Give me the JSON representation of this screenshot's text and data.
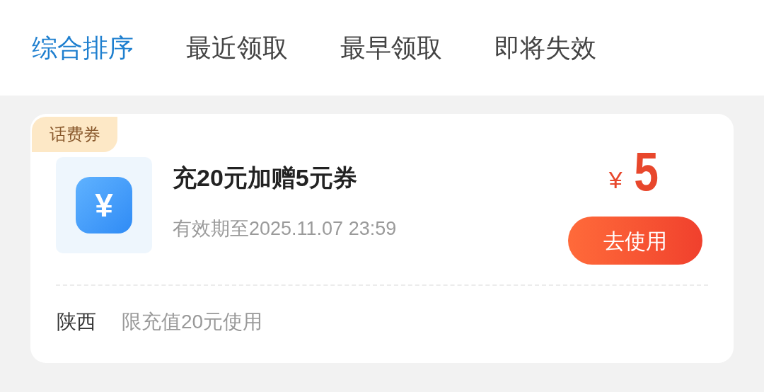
{
  "tabs": [
    {
      "label": "综合排序",
      "selected": true
    },
    {
      "label": "最近领取",
      "selected": false
    },
    {
      "label": "最早领取",
      "selected": false
    },
    {
      "label": "即将失效",
      "selected": false
    }
  ],
  "coupon": {
    "tag": "话费券",
    "icon_glyph": "¥",
    "title": "充20元加赠5元券",
    "expiry": "有效期至2025.11.07 23:59",
    "currency": "¥",
    "amount": "5",
    "button": "去使用",
    "region": "陕西",
    "condition": "限充值20元使用"
  }
}
